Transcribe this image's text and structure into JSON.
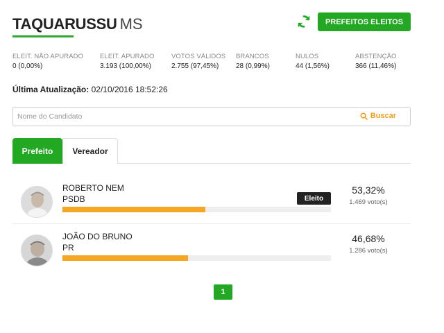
{
  "header": {
    "city": "TAQUARUSSU",
    "state": "MS",
    "refresh_icon": "refresh-icon",
    "prefeitos_button": "PREFEITOS ELEITOS"
  },
  "colors": {
    "green": "#22a822",
    "orange": "#f5a623",
    "badge_dark": "#222222"
  },
  "stats": [
    {
      "label": "ELEIT. NÃO APURADO",
      "value": "0 (0,00%)"
    },
    {
      "label": "ELEIT. APURADO",
      "value": "3.193 (100,00%)"
    },
    {
      "label": "VOTOS VÁLIDOS",
      "value": "2.755 (97,45%)"
    },
    {
      "label": "BRANCOS",
      "value": "28 (0,99%)"
    },
    {
      "label": "NULOS",
      "value": "44 (1,56%)"
    },
    {
      "label": "ABSTENÇÃO",
      "value": "366 (11,46%)"
    }
  ],
  "update": {
    "label": "Última Atualização:",
    "value": "02/10/2016 18:52:26"
  },
  "search": {
    "placeholder": "Nome do Candidato",
    "button_label": "Buscar",
    "icon": "search-icon"
  },
  "tabs": [
    {
      "label": "Prefeito",
      "active": true
    },
    {
      "label": "Vereador",
      "active": false
    }
  ],
  "candidates": [
    {
      "name": "ROBERTO NEM",
      "party": "PSDB",
      "badge": "Eleito",
      "percent": "53,32%",
      "votes": "1.469 voto(s)",
      "share": 0.5332
    },
    {
      "name": "JOÃO DO BRUNO",
      "party": "PR",
      "badge": "",
      "percent": "46,68%",
      "votes": "1.286 voto(s)",
      "share": 0.4668
    }
  ],
  "pagination": {
    "current_page": "1"
  }
}
